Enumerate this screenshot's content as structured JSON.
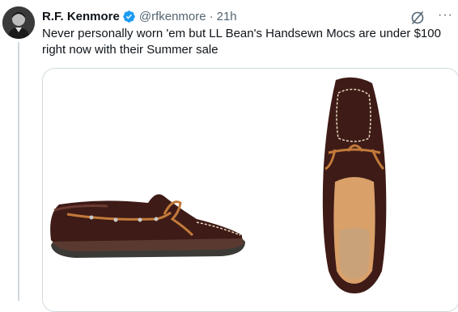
{
  "tweet": {
    "display_name": "R.F. Kenmore",
    "handle": "@rfkenmore",
    "separator": "·",
    "time": "21h",
    "text": "Never personally worn 'em but LL Bean's Handsewn Mocs are under $100 right now with their Summer sale"
  },
  "icons": {
    "verified": "verified-badge-icon",
    "grok": "grok-icon",
    "more": "more-icon",
    "more_glyph": "···"
  },
  "media": {
    "images": [
      {
        "name": "shoe-side-view-image",
        "subject": "moccasin-side-view"
      },
      {
        "name": "shoe-top-view-image",
        "subject": "moccasin-top-view"
      }
    ]
  },
  "colors": {
    "verified_blue": "#1d9bf0",
    "secondary_text": "#536471",
    "border": "#cfd9de",
    "leather": "#3e1b16",
    "lace": "#c27a3a",
    "lining": "#d9a06a"
  }
}
